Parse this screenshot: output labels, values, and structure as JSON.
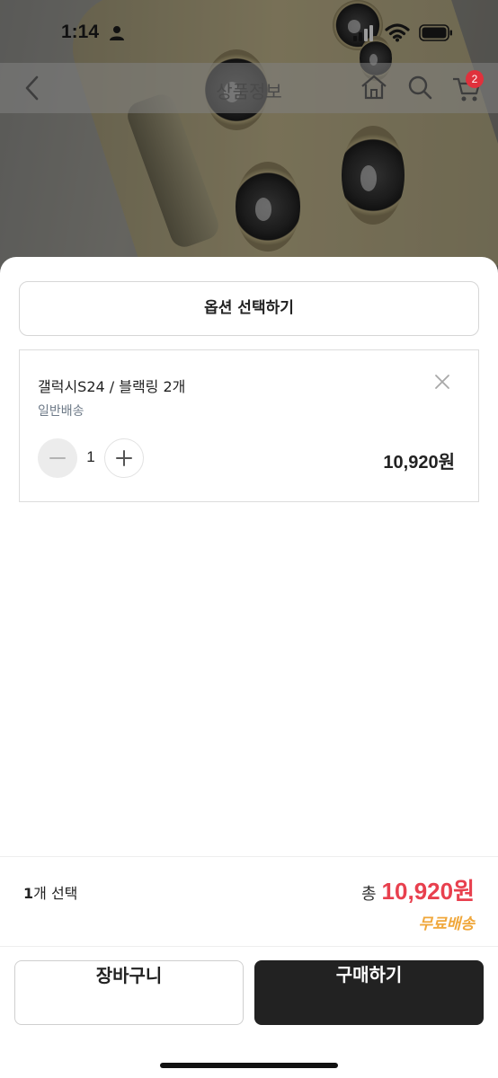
{
  "status_bar": {
    "time": "1:14"
  },
  "nav": {
    "title": "상품정보",
    "cart_badge": "2"
  },
  "sheet": {
    "option_select_label": "옵션 선택하기",
    "selected_item": {
      "name": "갤럭시S24 / 블랙링 2개",
      "shipping": "일반배송",
      "quantity": "1",
      "price": "10,920원"
    },
    "summary": {
      "count_number": "1",
      "count_suffix": "개 선택",
      "total_label": "총",
      "total_amount": "10,920원",
      "free_shipping": "무료배송"
    },
    "buttons": {
      "cart": "장바구니",
      "buy": "구매하기"
    }
  },
  "colors": {
    "accent_red": "#e8404e",
    "free_shipping_orange": "#f0a73a",
    "badge_red": "#e0313c",
    "buy_button": "#222222"
  },
  "icons": [
    "person-icon",
    "signal-icon",
    "wifi-icon",
    "battery-icon",
    "back-arrow-icon",
    "home-icon",
    "search-icon",
    "cart-icon",
    "close-icon",
    "minus-icon",
    "plus-icon"
  ]
}
